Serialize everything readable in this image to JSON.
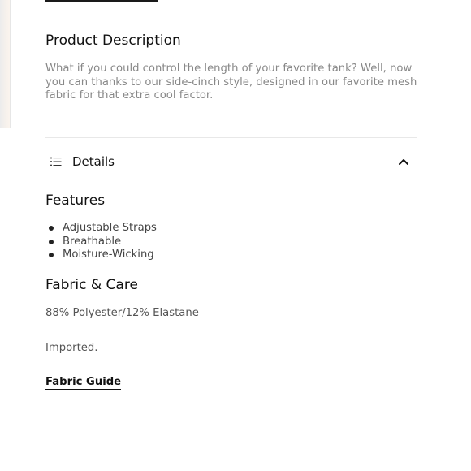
{
  "product_description": {
    "title": "Product Description",
    "text": "What if you could control the length of your favorite tank? Well, now you can thanks to our side-cinch style, designed in our favorite mesh fabric for that extra cool factor."
  },
  "details": {
    "label": "Details",
    "expanded": true
  },
  "features": {
    "title": "Features",
    "items": [
      "Adjustable Straps",
      "Breathable",
      "Moisture-Wicking"
    ]
  },
  "fabric_care": {
    "title": "Fabric & Care",
    "composition": "88% Polyester/12% Elastane",
    "origin": "Imported.",
    "guide_link": "Fabric Guide"
  },
  "icons": {
    "details": "list-icon",
    "toggle": "chevron-up-icon"
  }
}
